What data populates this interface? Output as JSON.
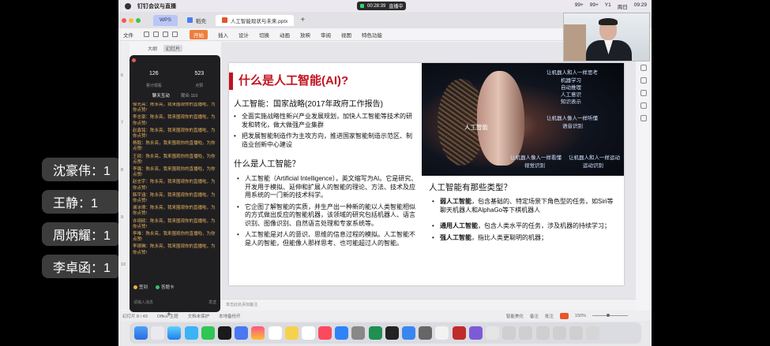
{
  "menubar": {
    "app_name": "钉钉会议与直播",
    "live_timer": "00:28:39",
    "live_label": "直播中",
    "status_items": [
      "99+",
      "99+",
      "Y1",
      "周日",
      "09:29"
    ]
  },
  "tabs": [
    {
      "label": "WPS"
    },
    {
      "label": "稻壳"
    },
    {
      "label": "人工智能现状与未来.pptx"
    }
  ],
  "ribbon": {
    "items": [
      "文件",
      "开始",
      "插入",
      "设计",
      "切换",
      "动画",
      "放映",
      "审阅",
      "视图",
      "特色功能"
    ],
    "start_label": "开始"
  },
  "panel_tabs": [
    "大纲",
    "幻灯片"
  ],
  "chat": {
    "stats": [
      {
        "value": "126",
        "label": "累计观看"
      },
      {
        "value": "523",
        "label": "点赞"
      }
    ],
    "tabs": [
      "聊天互动",
      "观众·110"
    ],
    "messages": [
      "徐光亮：陈永亮，我来围观你的直播啦，为你点赞!",
      "李志豪：陈永亮，我来围观你的直播啦，为你点赞!",
      "赵鑫铭：陈永亮，我来围观你的直播啦，为你点赞!",
      "杨毅：陈永亮，我来围观你的直播啦，为你点赞!",
      "王硕：陈永亮，我来围观你的直播啦，为你点赞!",
      "李璐：陈永亮，我来围观你的直播啦，为你点赞!",
      "赵志宇：陈永亮，我来围观你的直播啦，为你点赞!",
      "韩宇涵：陈永亮，我来围观你的直播啦，为你点赞!",
      "谢冰倩：陈永亮，我来围观你的直播啦，为你点赞!",
      "许翊硕：陈永亮，我来围观你的直播啦，为你点赞!",
      "李唯：陈永亮，我来围观你的直播啦，为你点赞!",
      "李璟琳：陈永亮，我来围观你的直播啦，为你点赞!"
    ],
    "actions": [
      "签到",
      "答题卡"
    ],
    "input_placeholder": "请输入消息",
    "send_label": "发送"
  },
  "slide": {
    "title": "什么是人工智能(AI)?",
    "subtitle": "人工智能：国家战略(2017年政府工作报告)",
    "bullets_top": [
      "全面实施战略性新兴产业发展规划，加快人工智能等技术的研发和转化，做大做强产业集群",
      "把发展智能制造作为主攻方向，推进国家智能制造示范区、制造业创新中心建设"
    ],
    "heading2": "什么是人工智能？",
    "bullets_mid": [
      "人工智能（Artificial Intelligence），英文缩写为AI。它是研究、开发用于模拟、延伸和扩展人的智能的理论、方法、技术及应用系统的一门新的技术科学。",
      "它企图了解智能的实质，并生产出一种新的能以人类智能相似的方式做出反应的智能机器，该领域的研究包括机器人、语言识别、图像识别、自然语言处理和专家系统等。",
      "人工智能是对人的意识、思维的信息过程的模拟。人工智能不是人的智能，但能像人那样思考、也可能超过人的智能。"
    ],
    "heading3": "人工智能有那些类型？",
    "types": [
      {
        "bold": "弱人工智能",
        "text": "，包含基础的、特定场景下角色型的任务，如Siri等聊天机器人和AlphaGo等下棋机器人"
      },
      {
        "bold": "通用人工智能",
        "text": "，包含人类水平的任务，涉及机器的持续学习；"
      },
      {
        "bold": "强人工智能",
        "text": "，指比人类更聪明的机器；"
      }
    ],
    "image_labels": {
      "center": "人工智能",
      "group1_title": "让机器人和人一样思考",
      "group1_items": [
        "机器学习",
        "自动推理",
        "人工意识",
        "知识表示"
      ],
      "group2_title": "让机器人像人一样听懂",
      "group2_items": [
        "语音识别"
      ],
      "group3_title": "让机器人像人一样看懂",
      "group3_items": [
        "视觉识别"
      ],
      "group4_title": "让机器人和人一样运动",
      "group4_items": [
        "运动识别"
      ]
    }
  },
  "notes_placeholder": "单击此处添加备注",
  "statusbar": {
    "slide_info": "幻灯片 8 / 49",
    "theme": "Office 主题",
    "backup": "文档未保护",
    "local": "本地备份开",
    "beautify": "智能美化",
    "notes": "备注",
    "comments": "批注",
    "zoom": "150%"
  },
  "names_overlay": [
    "沈豪伟：1",
    "王静：1",
    "周炳耀：1",
    "李卓函：1"
  ]
}
